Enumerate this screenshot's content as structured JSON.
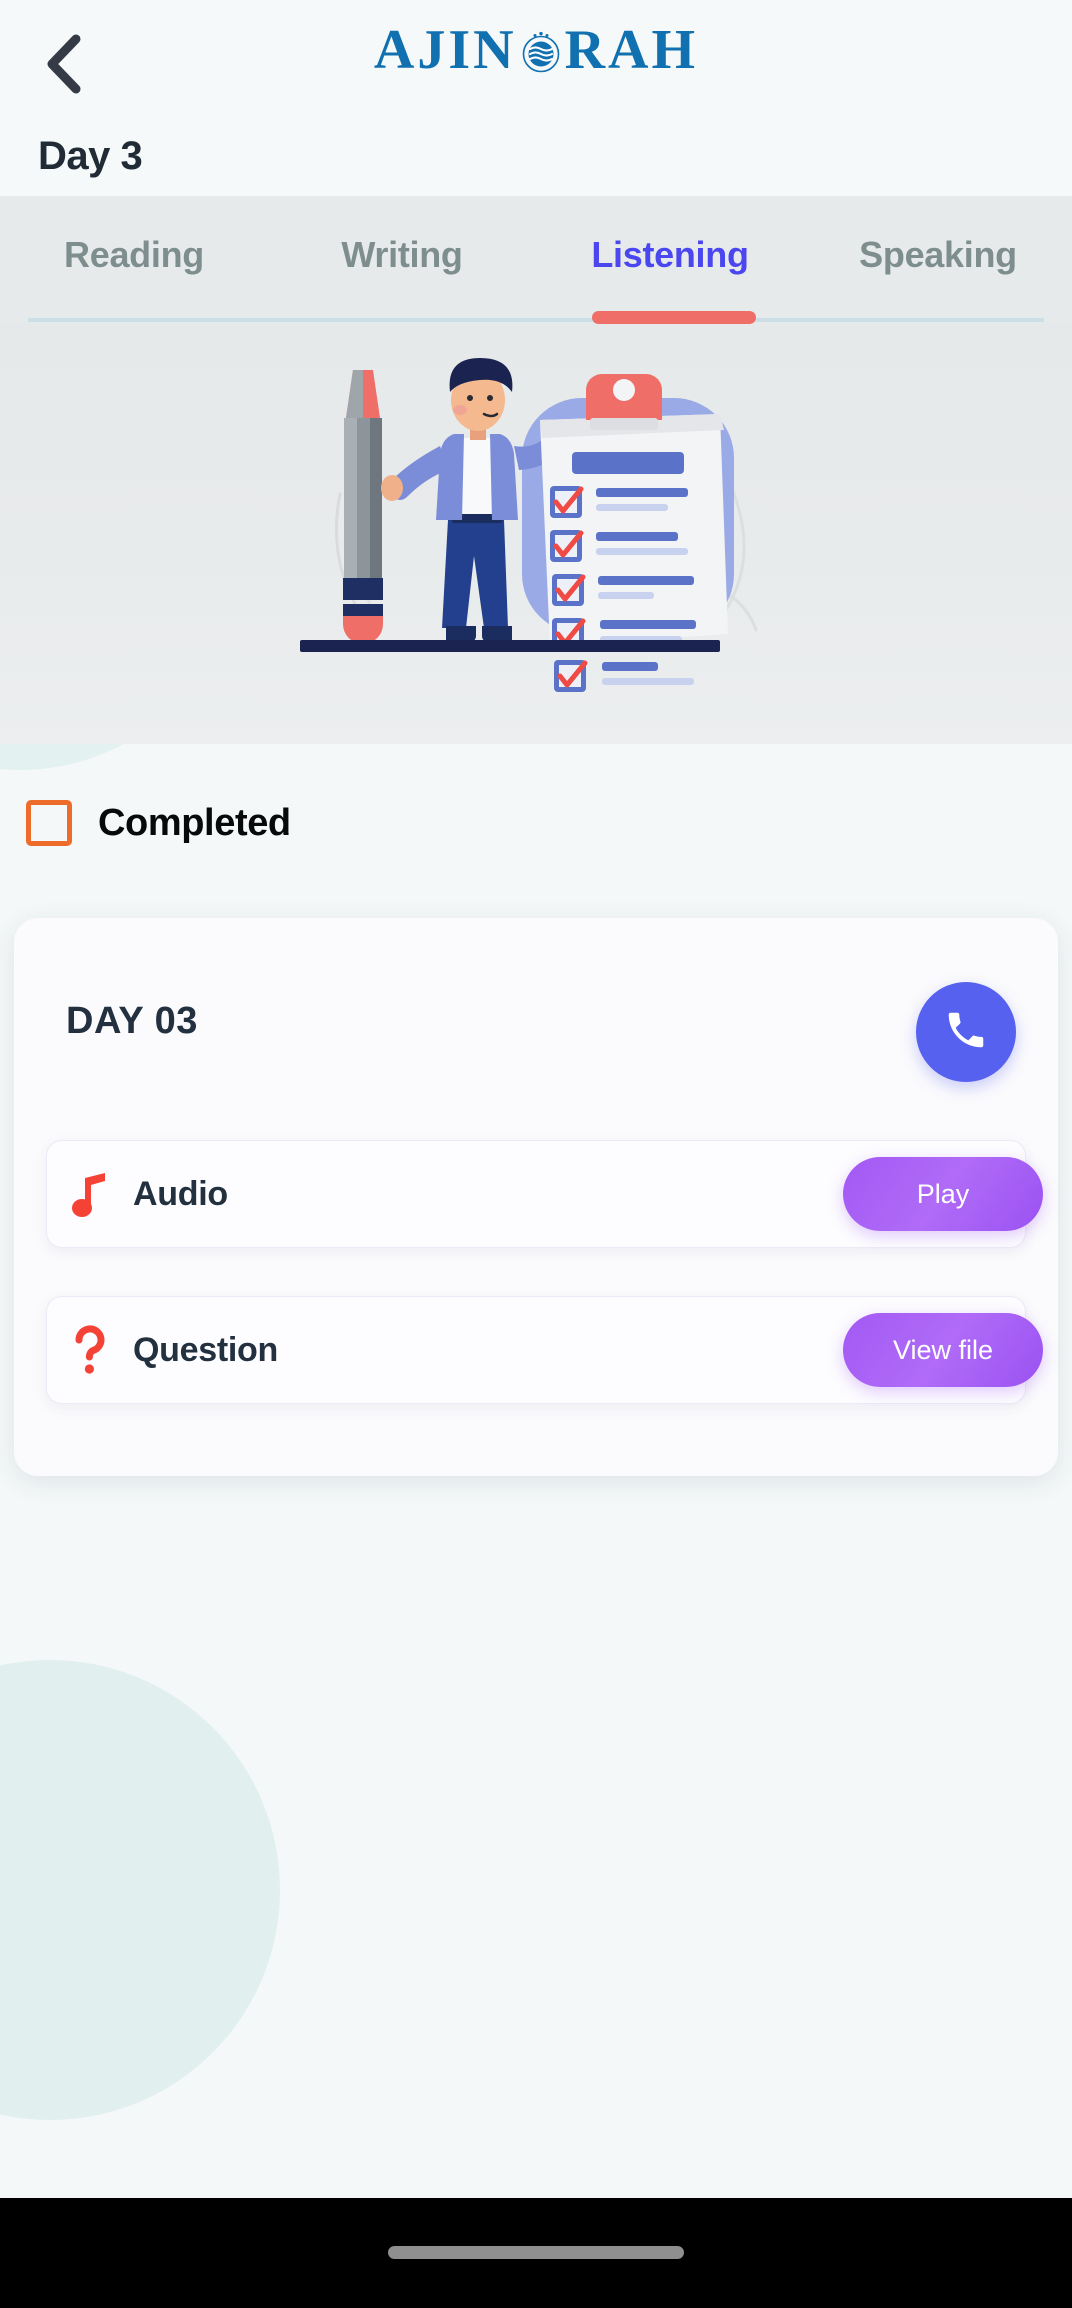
{
  "app": {
    "brand_left": "AJIN",
    "brand_right": "RAH",
    "brand_emblem_icon": "globe-wave-emblem-icon",
    "background_color": "#f4f8f8"
  },
  "header": {
    "back_icon": "chevron-left-icon",
    "page_title": "Day 3"
  },
  "tabs": {
    "items": [
      {
        "label": "Reading",
        "active": false
      },
      {
        "label": "Writing",
        "active": false
      },
      {
        "label": "Listening",
        "active": true
      },
      {
        "label": "Speaking",
        "active": false
      }
    ],
    "active_color": "#4a46f0",
    "inactive_color": "#7e8d8d",
    "indicator_color": "#ef6e68"
  },
  "illustration": {
    "name": "person-with-pencil-and-checklist-illustration",
    "elements": [
      "standing-person",
      "giant-pencil",
      "clipboard-with-checked-items"
    ],
    "checklist_item_count": 5
  },
  "completed": {
    "label": "Completed",
    "checked": false,
    "checkbox_color": "#ed6c2a"
  },
  "card": {
    "day_label": "DAY 03",
    "call_button": {
      "icon": "phone-icon",
      "color": "#5761f0"
    },
    "rows": [
      {
        "icon": "music-note-icon",
        "icon_color": "#f44336",
        "label": "Audio",
        "action_label": "Play"
      },
      {
        "icon": "question-mark-icon",
        "icon_color": "#f44336",
        "label": "Question",
        "action_label": "View file"
      }
    ],
    "action_gradient_start": "#a259f4",
    "action_gradient_end": "#9b52f2"
  },
  "system": {
    "home_indicator": "home-indicator-bar"
  }
}
